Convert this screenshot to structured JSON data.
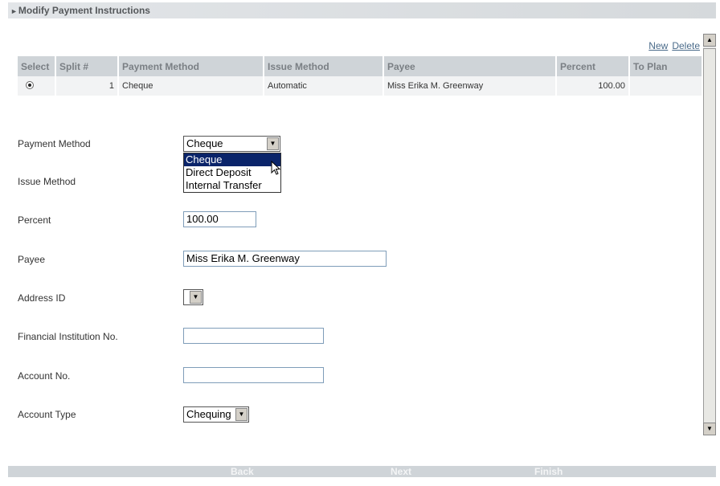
{
  "header": {
    "title": "Modify Payment Instructions"
  },
  "actions": {
    "new": "New",
    "delete": "Delete"
  },
  "table": {
    "columns": [
      "Select",
      "Split #",
      "Payment Method",
      "Issue Method",
      "Payee",
      "Percent",
      "To Plan"
    ],
    "rows": [
      {
        "split": "1",
        "payment_method": "Cheque",
        "issue_method": "Automatic",
        "payee": "Miss Erika M. Greenway",
        "percent": "100.00",
        "to_plan": ""
      }
    ]
  },
  "form": {
    "payment_method": {
      "label": "Payment Method",
      "value": "Cheque",
      "options": [
        "Cheque",
        "Direct Deposit",
        "Internal Transfer"
      ]
    },
    "issue_method": {
      "label": "Issue Method"
    },
    "percent": {
      "label": "Percent",
      "value": "100.00"
    },
    "payee": {
      "label": "Payee",
      "value": "Miss Erika M. Greenway"
    },
    "address_id": {
      "label": "Address ID",
      "value": ""
    },
    "financial_institution": {
      "label": "Financial Institution No.",
      "value": ""
    },
    "account_no": {
      "label": "Account No.",
      "value": ""
    },
    "account_type": {
      "label": "Account Type",
      "value": "Chequing"
    }
  },
  "footer": {
    "back": "Back",
    "next": "Next",
    "finish": "Finish"
  }
}
